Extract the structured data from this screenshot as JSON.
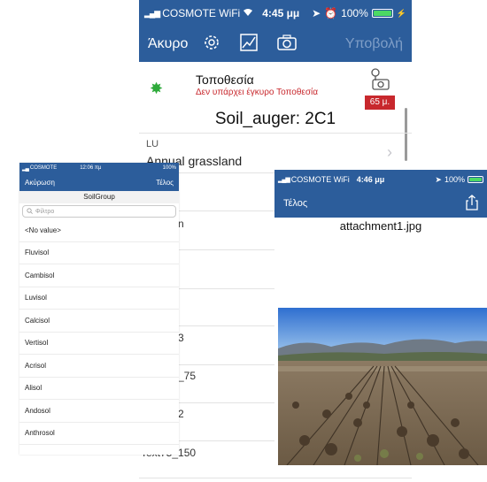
{
  "screen_a": {
    "status": {
      "carrier": "COSMOTE WiFi",
      "time": "4:45 μμ",
      "battery": "100%"
    },
    "toolbar": {
      "cancel_label": "Άκυρο",
      "submit_label": "Υποβολή"
    },
    "location": {
      "title": "Τοποθεσία",
      "subtitle": "Δεν υπάρχει έγκυρο Τοποθεσία",
      "distance": "65 μ."
    },
    "form_title": "Soil_auger: 2C1",
    "fields": [
      {
        "label": "LU",
        "value": "Annual grassland"
      }
    ],
    "partials": [
      "n",
      "3",
      "_75",
      "2",
      "Text75_150"
    ]
  },
  "screen_b": {
    "status": {
      "carrier": "COSMOTE",
      "time": "12:06 πμ",
      "battery": "100%"
    },
    "nav": {
      "cancel_label": "Ακύρωση",
      "done_label": "Τέλος"
    },
    "group_title": "SoilGroup",
    "filter_placeholder": "Φίλτρο",
    "options": [
      "<No value>",
      "Fluvisol",
      "Cambisol",
      "Luvisol",
      "Calcisol",
      "Vertisol",
      "Acrisol",
      "Alisol",
      "Andosol",
      "Anthrosol"
    ]
  },
  "screen_c": {
    "status": {
      "carrier": "COSMOTE WiFi",
      "time": "4:46 μμ",
      "battery": "100%"
    },
    "nav": {
      "done_label": "Τέλος"
    },
    "attachment_title": "attachment1.jpg"
  },
  "colors": {
    "bar": "#2c5d9b",
    "error": "#c8282d",
    "valid": "#2eaa3a",
    "battery": "#4cd964"
  }
}
